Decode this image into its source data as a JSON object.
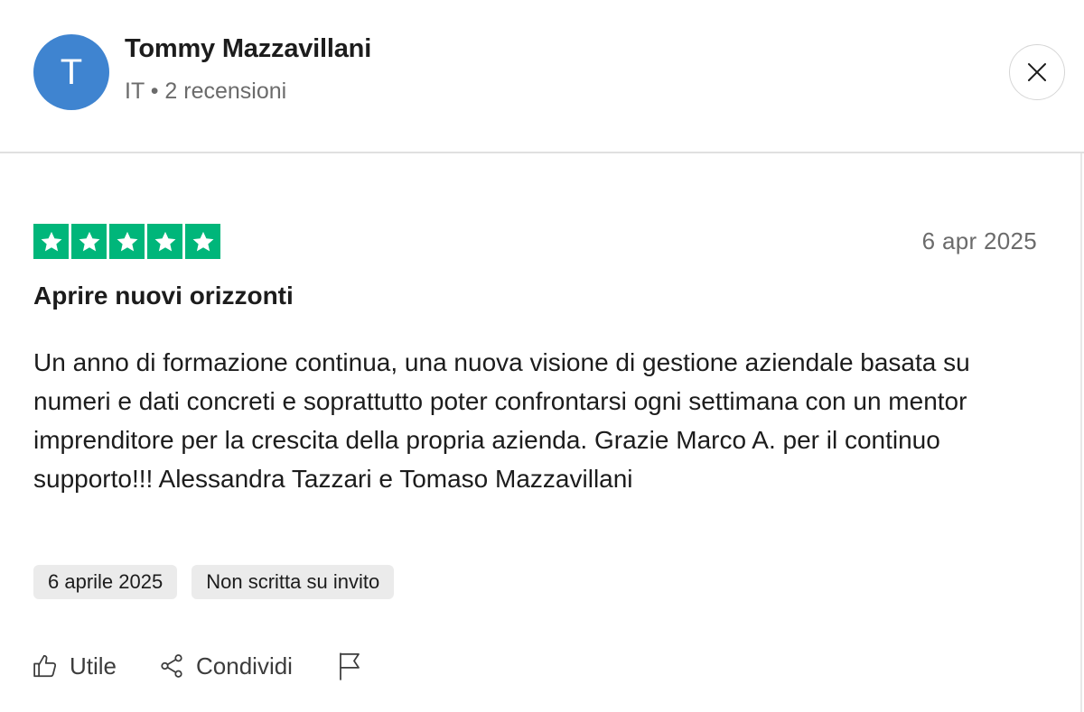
{
  "reviewer": {
    "avatar_initial": "T",
    "avatar_color": "#3f84d0",
    "name": "Tommy Mazzavillani",
    "meta": "IT • 2 recensioni"
  },
  "close_icon": "close-icon",
  "review": {
    "rating": 5,
    "rating_max": 5,
    "star_color": "#00b67a",
    "date": "6 apr 2025",
    "title": "Aprire nuovi orizzonti",
    "body": "Un anno di formazione continua, una nuova visione di gestione aziendale basata su numeri e dati concreti e soprattutto poter confrontarsi ogni settimana con un mentor imprenditore per la crescita della propria azienda. Grazie Marco A. per il continuo supporto!!! Alessandra Tazzari e Tomaso Mazzavillani",
    "tags": [
      "6 aprile 2025",
      "Non scritta su invito"
    ]
  },
  "actions": {
    "useful_label": "Utile",
    "useful_icon": "thumbs-up-icon",
    "share_label": "Condividi",
    "share_icon": "share-icon",
    "report_icon": "flag-icon"
  }
}
